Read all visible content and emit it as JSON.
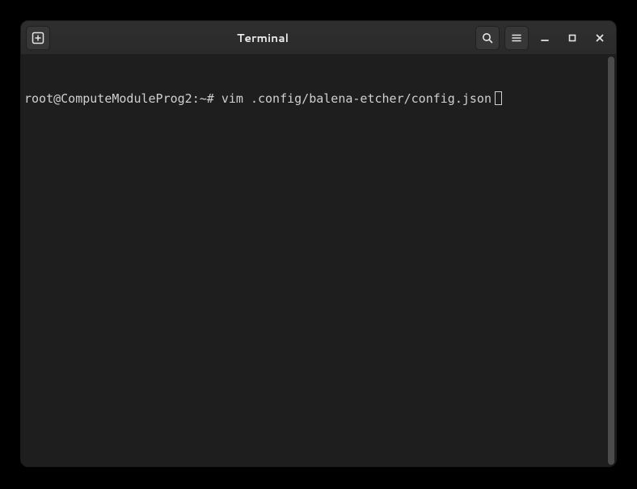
{
  "window": {
    "title": "Terminal"
  },
  "terminal": {
    "prompt": "root@ComputeModuleProg2:~# ",
    "command": "vim .config/balena-etcher/config.json"
  },
  "icons": {
    "new_tab": "new-tab-icon",
    "search": "search-icon",
    "menu": "menu-icon",
    "minimize": "minimize-icon",
    "maximize": "maximize-icon",
    "close": "close-icon"
  },
  "colors": {
    "window_bg": "#2b2b2b",
    "terminal_bg": "#1e1e1e",
    "text": "#d0d0d0",
    "btn_bg": "#373737"
  }
}
